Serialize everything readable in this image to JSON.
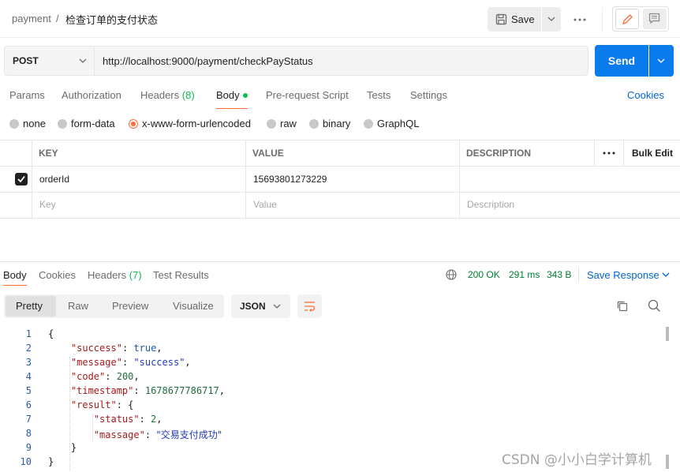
{
  "breadcrumb": {
    "parent": "payment",
    "separator": "/",
    "title": "检查订单的支付状态"
  },
  "header": {
    "save_label": "Save"
  },
  "request": {
    "method": "POST",
    "url": "http://localhost:9000/payment/checkPayStatus",
    "send_label": "Send"
  },
  "request_tabs": [
    {
      "label": "Params"
    },
    {
      "label": "Authorization"
    },
    {
      "label": "Headers",
      "count": "(8)"
    },
    {
      "label": "Body",
      "active": true
    },
    {
      "label": "Pre-request Script"
    },
    {
      "label": "Tests"
    },
    {
      "label": "Settings"
    }
  ],
  "cookies_label": "Cookies",
  "body_types": [
    {
      "label": "none"
    },
    {
      "label": "form-data"
    },
    {
      "label": "x-www-form-urlencoded",
      "selected": true
    },
    {
      "label": "raw"
    },
    {
      "label": "binary"
    },
    {
      "label": "GraphQL"
    }
  ],
  "params_table": {
    "headers": {
      "key": "KEY",
      "value": "VALUE",
      "description": "DESCRIPTION",
      "bulk_edit": "Bulk Edit"
    },
    "rows": [
      {
        "key": "orderId",
        "value": "15693801273229",
        "description": "",
        "checked": true
      }
    ],
    "placeholders": {
      "key": "Key",
      "value": "Value",
      "description": "Description"
    }
  },
  "response": {
    "tabs": [
      {
        "label": "Body",
        "active": true
      },
      {
        "label": "Cookies"
      },
      {
        "label": "Headers",
        "count": "(7)"
      },
      {
        "label": "Test Results"
      }
    ],
    "status": "200 OK",
    "time": "291 ms",
    "size": "343 B",
    "save_response_label": "Save Response",
    "formats": [
      "Pretty",
      "Raw",
      "Preview",
      "Visualize"
    ],
    "active_format": "Pretty",
    "language": "JSON",
    "line_numbers": [
      "1",
      "2",
      "3",
      "4",
      "5",
      "6",
      "7",
      "8",
      "9",
      "10"
    ],
    "json": {
      "open_brace": "{",
      "success_key": "\"success\"",
      "success_val": "true",
      "message_key": "\"message\"",
      "message_val": "\"success\"",
      "code_key": "\"code\"",
      "code_val": "200",
      "timestamp_key": "\"timestamp\"",
      "timestamp_val": "1678677786717",
      "result_key": "\"result\"",
      "result_open": "{",
      "status_key": "\"status\"",
      "status_val": "2",
      "massage_key": "\"massage\"",
      "massage_val": "\"交易支付成功\"",
      "result_close": "}",
      "close_brace": "}"
    }
  },
  "watermark": "CSDN @小小白学计算机",
  "colors": {
    "accent": "#ff6c37",
    "send_blue": "#097bed",
    "link_blue": "#0265d2",
    "status_green": "#007f31",
    "count_green": "#0cbb52"
  }
}
